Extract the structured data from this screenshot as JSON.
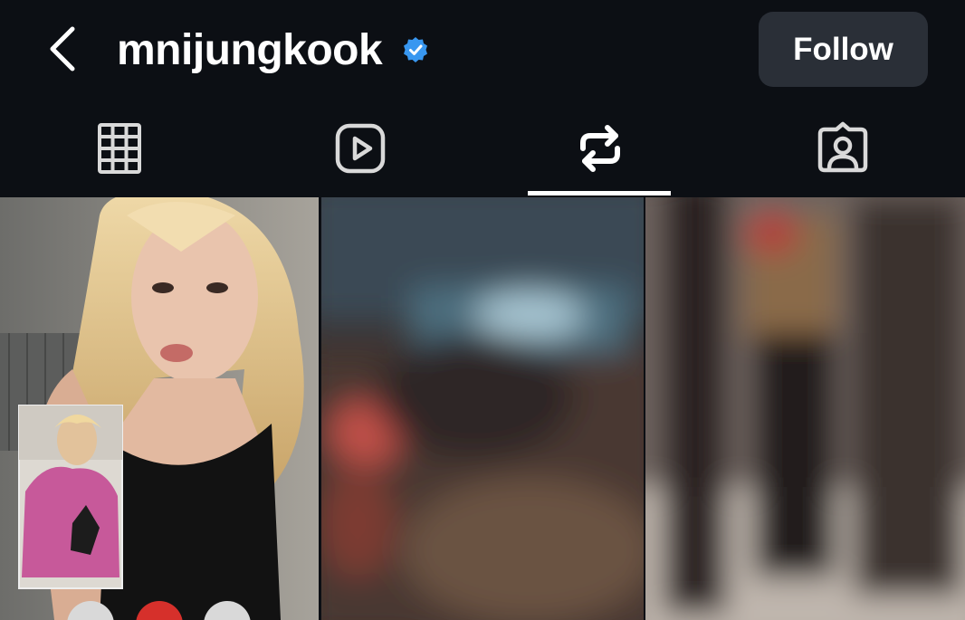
{
  "header": {
    "username": "mnijungkook",
    "verified": true,
    "follow_label": "Follow"
  },
  "tabs": [
    {
      "name": "posts",
      "icon": "grid-icon",
      "active": false
    },
    {
      "name": "reels",
      "icon": "reels-play-icon",
      "active": false
    },
    {
      "name": "reposts",
      "icon": "repost-icon",
      "active": true
    },
    {
      "name": "tagged",
      "icon": "tagged-person-icon",
      "active": false
    }
  ],
  "colors": {
    "background": "#0c0f14",
    "button": "#2a2f37",
    "verified_badge": "#3897f0",
    "text": "#ffffff",
    "icon_inactive": "#d9d9d9"
  },
  "grid": {
    "items": [
      {
        "type": "image",
        "description_icon": "photo-thumbnail"
      },
      {
        "type": "image",
        "description_icon": "blurred-photo-thumbnail"
      },
      {
        "type": "image",
        "description_icon": "blurred-photo-thumbnail"
      }
    ]
  }
}
